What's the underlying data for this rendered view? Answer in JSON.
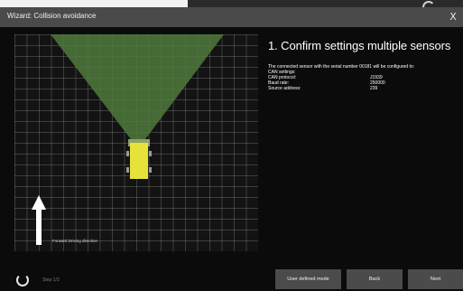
{
  "window": {
    "title": "Wizard: Collision avoidance",
    "close_glyph": "X"
  },
  "visualization": {
    "direction_label": "Forward Driving direction",
    "grid_color": "#969696",
    "detection_zone_color": "#4f7a3c",
    "vehicle_color": "#e6e23a"
  },
  "panel": {
    "heading": "1. Confirm settings multiple sensors",
    "description": "The connected sensor with the serial number 00181 will be configured to:",
    "settings_title": "CAN settings:",
    "settings": [
      {
        "label": "CAN protocol:",
        "value": "J1939"
      },
      {
        "label": "Baud rate:",
        "value": "250000"
      },
      {
        "label": "Source address:",
        "value": "239"
      }
    ]
  },
  "footer": {
    "step_text": "Step 1/3",
    "buttons": {
      "user_defined": "User defined mode",
      "back": "Back",
      "next": "Next"
    }
  },
  "icons": {
    "spinner": "loading-spinner-icon",
    "arrow": "arrow-up-icon",
    "close": "close-icon"
  }
}
